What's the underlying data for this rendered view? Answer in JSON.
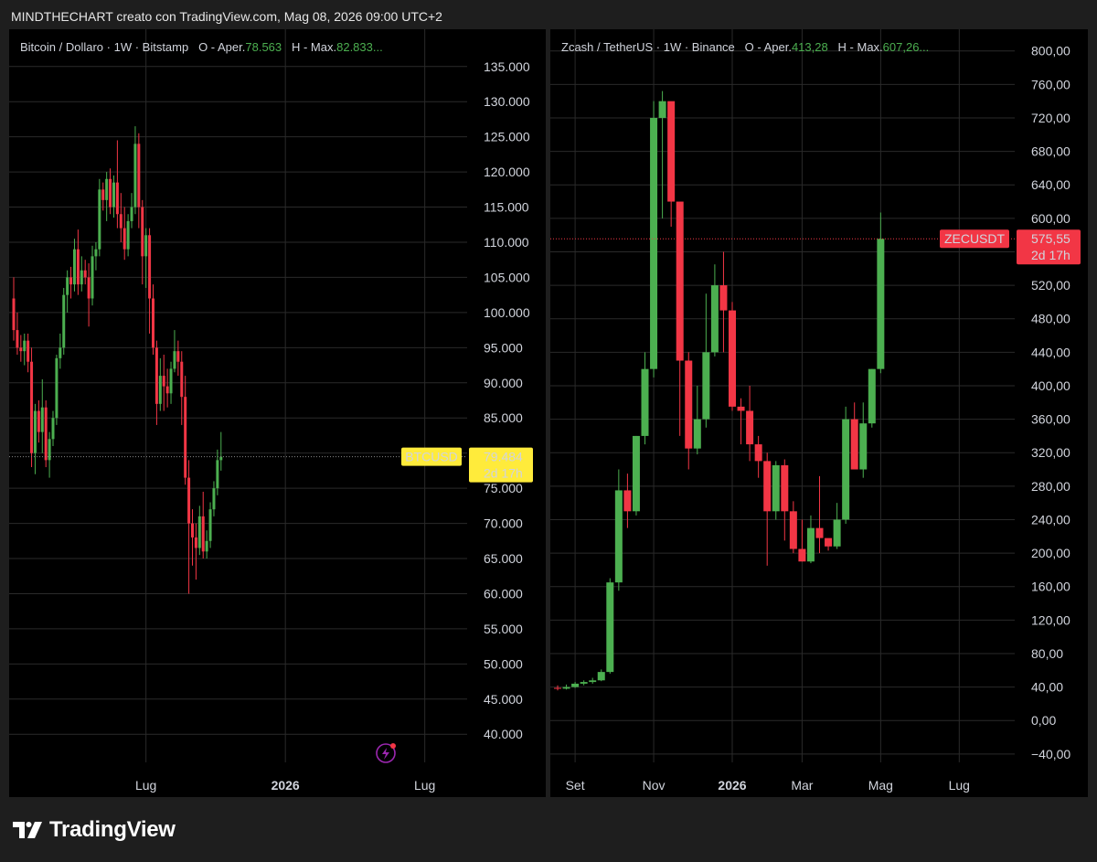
{
  "header": {
    "caption": "MINDTHECHART creato con TradingView.com, Mag 08, 2026 09:00 UTC+2"
  },
  "brand": {
    "name": "TradingView"
  },
  "colors": {
    "up": "#4caf50",
    "down": "#f23645",
    "grid": "#2a2a2a",
    "panel_bg": "#000000",
    "page_bg": "#1e1e1e",
    "btc_tag": "#ffeb3b",
    "zec_tag": "#f23645"
  },
  "icons": {
    "alert": "lightning-icon",
    "logo": "tradingview-logo-icon"
  },
  "left": {
    "legend": {
      "symbol": "Bitcoin / Dollaro · 1W · Bitstamp",
      "o_label": "O - Aper.",
      "o_value": "78.563",
      "h_label": "H - Max.",
      "h_value": "82.833..."
    },
    "tag": {
      "symbol": "BTCUSD",
      "price": "79.484",
      "countdown": "2d 17h"
    }
  },
  "right": {
    "legend": {
      "symbol": "Zcash / TetherUS · 1W · Binance",
      "o_label": "O - Aper.",
      "o_value": "413,28",
      "h_label": "H - Max.",
      "h_value": "607,26..."
    },
    "tag": {
      "symbol": "ZECUSDT",
      "price": "575,55",
      "countdown": "2d 17h"
    }
  },
  "chart_data": [
    {
      "type": "candlestick",
      "title": "Bitcoin / Dollaro · 1W · Bitstamp",
      "ylim": [
        36000,
        139000
      ],
      "yticks": [
        40000,
        45000,
        50000,
        55000,
        60000,
        65000,
        70000,
        75000,
        80000,
        85000,
        90000,
        95000,
        100000,
        105000,
        110000,
        115000,
        120000,
        125000,
        130000,
        135000
      ],
      "ytick_labels": [
        "40.000",
        "45.000",
        "50.000",
        "55.000",
        "60.000",
        "65.000",
        "70.000",
        "75.000",
        "80.000",
        "85.000",
        "90.000",
        "95.000",
        "100.000",
        "105.000",
        "110.000",
        "115.000",
        "120.000",
        "125.000",
        "130.000",
        "135.000"
      ],
      "xticks": [
        {
          "label": "Lug",
          "index": 37,
          "bold": false
        },
        {
          "label": "2026",
          "index": 76,
          "bold": true
        },
        {
          "label": "Lug",
          "index": 115,
          "bold": false
        }
      ],
      "last_price": 79484,
      "candles": [
        [
          102000,
          105000,
          96000,
          97500
        ],
        [
          97500,
          100000,
          94000,
          95000
        ],
        [
          95000,
          96800,
          93000,
          94500
        ],
        [
          94500,
          97000,
          92500,
          96000
        ],
        [
          96000,
          97000,
          91500,
          93000
        ],
        [
          93000,
          95000,
          78000,
          80000
        ],
        [
          80000,
          87000,
          77000,
          86000
        ],
        [
          86000,
          87500,
          81500,
          83000
        ],
        [
          83000,
          90500,
          80000,
          86500
        ],
        [
          86500,
          87500,
          78000,
          79000
        ],
        [
          79000,
          83000,
          76500,
          82000
        ],
        [
          82000,
          86000,
          81000,
          85000
        ],
        [
          85000,
          94000,
          84000,
          93500
        ],
        [
          93500,
          97000,
          92000,
          95000
        ],
        [
          95000,
          103500,
          94000,
          102500
        ],
        [
          102500,
          106000,
          100000,
          105000
        ],
        [
          105000,
          106500,
          102000,
          104000
        ],
        [
          104000,
          110500,
          103000,
          109000
        ],
        [
          109000,
          111800,
          102500,
          104000
        ],
        [
          104000,
          108000,
          103000,
          106000
        ],
        [
          106000,
          107500,
          104000,
          105000
        ],
        [
          105000,
          107000,
          98000,
          102000
        ],
        [
          102000,
          109500,
          101000,
          108000
        ],
        [
          108000,
          110000,
          106000,
          109000
        ],
        [
          109000,
          119000,
          108000,
          117500
        ],
        [
          117500,
          118500,
          114500,
          116000
        ],
        [
          116000,
          120000,
          113000,
          119000
        ],
        [
          119000,
          120500,
          114000,
          115000
        ],
        [
          115000,
          119500,
          113500,
          118500
        ],
        [
          118500,
          124500,
          112000,
          114000
        ],
        [
          114000,
          117000,
          110000,
          112000
        ],
        [
          112000,
          115000,
          107500,
          109000
        ],
        [
          109000,
          114000,
          108000,
          113000
        ],
        [
          113000,
          117000,
          112000,
          115000
        ],
        [
          115000,
          126500,
          114000,
          124000
        ],
        [
          124000,
          125500,
          112000,
          115000
        ],
        [
          115000,
          116000,
          104000,
          108000
        ],
        [
          108000,
          112000,
          103500,
          111000
        ],
        [
          111000,
          112000,
          97000,
          102000
        ],
        [
          102000,
          104000,
          94000,
          95000
        ],
        [
          95000,
          96000,
          84000,
          87000
        ],
        [
          87000,
          93500,
          86000,
          91000
        ],
        [
          91000,
          94000,
          86000,
          89500
        ],
        [
          89500,
          92000,
          86500,
          88500
        ],
        [
          88500,
          93000,
          87000,
          92000
        ],
        [
          92000,
          97500,
          91500,
          94500
        ],
        [
          94500,
          96000,
          91000,
          93000
        ],
        [
          93000,
          94500,
          84000,
          88000
        ],
        [
          88000,
          91000,
          75500,
          76500
        ],
        [
          76500,
          79000,
          60000,
          70000
        ],
        [
          70000,
          72000,
          64000,
          68000
        ],
        [
          68000,
          70000,
          62000,
          66500
        ],
        [
          66500,
          72500,
          65500,
          71000
        ],
        [
          71000,
          74500,
          65000,
          66000
        ],
        [
          66000,
          69000,
          65000,
          67500
        ],
        [
          67500,
          73000,
          66500,
          72000
        ],
        [
          72000,
          76000,
          71000,
          75000
        ],
        [
          75000,
          80500,
          74000,
          79000
        ],
        [
          79000,
          83000,
          77500,
          79484
        ]
      ]
    },
    {
      "type": "candlestick",
      "title": "Zcash / TetherUS · 1W · Binance",
      "ylim": [
        -50,
        815
      ],
      "yticks": [
        -40,
        0,
        40,
        80,
        120,
        160,
        200,
        240,
        280,
        320,
        360,
        400,
        440,
        480,
        520,
        560,
        600,
        640,
        680,
        720,
        760,
        800
      ],
      "ytick_labels": [
        "−40,00",
        "0,00",
        "40,00",
        "80,00",
        "120,00",
        "160,00",
        "200,00",
        "240,00",
        "280,00",
        "320,00",
        "360,00",
        "400,00",
        "440,00",
        "480,00",
        "520,00",
        "560,00",
        "600,00",
        "640,00",
        "680,00",
        "720,00",
        "760,00",
        "800,00"
      ],
      "xticks": [
        {
          "label": "Set",
          "index": 2,
          "bold": false
        },
        {
          "label": "Nov",
          "index": 11,
          "bold": false
        },
        {
          "label": "2026",
          "index": 20,
          "bold": true
        },
        {
          "label": "Mar",
          "index": 28,
          "bold": false
        },
        {
          "label": "Mag",
          "index": 37,
          "bold": false
        },
        {
          "label": "Lug",
          "index": 46,
          "bold": false
        }
      ],
      "last_price": 575.55,
      "candles": [
        [
          39,
          42,
          36,
          38
        ],
        [
          38,
          43,
          37,
          40
        ],
        [
          40,
          46,
          39,
          44
        ],
        [
          44,
          48,
          42,
          46
        ],
        [
          46,
          51,
          44,
          48
        ],
        [
          48,
          61,
          47,
          58
        ],
        [
          58,
          170,
          56,
          165
        ],
        [
          165,
          300,
          155,
          275
        ],
        [
          275,
          295,
          230,
          250
        ],
        [
          250,
          340,
          245,
          340
        ],
        [
          340,
          440,
          330,
          420
        ],
        [
          420,
          740,
          410,
          720
        ],
        [
          720,
          752,
          600,
          740
        ],
        [
          740,
          735,
          590,
          620
        ],
        [
          620,
          610,
          340,
          430
        ],
        [
          430,
          440,
          300,
          325
        ],
        [
          325,
          400,
          318,
          360
        ],
        [
          360,
          510,
          350,
          440
        ],
        [
          440,
          545,
          435,
          520
        ],
        [
          520,
          560,
          440,
          490
        ],
        [
          490,
          500,
          370,
          375
        ],
        [
          375,
          385,
          330,
          370
        ],
        [
          370,
          400,
          310,
          330
        ],
        [
          330,
          340,
          290,
          310
        ],
        [
          310,
          320,
          185,
          250
        ],
        [
          250,
          310,
          240,
          305
        ],
        [
          305,
          312,
          215,
          250
        ],
        [
          250,
          262,
          200,
          205
        ],
        [
          205,
          240,
          190,
          190
        ],
        [
          190,
          245,
          188,
          230
        ],
        [
          230,
          292,
          200,
          218
        ],
        [
          218,
          215,
          203,
          208
        ],
        [
          208,
          260,
          205,
          240
        ],
        [
          240,
          375,
          235,
          360
        ],
        [
          360,
          380,
          330,
          300
        ],
        [
          300,
          380,
          290,
          355
        ],
        [
          355,
          420,
          350,
          420
        ],
        [
          420,
          607,
          415,
          575.55
        ]
      ]
    }
  ]
}
